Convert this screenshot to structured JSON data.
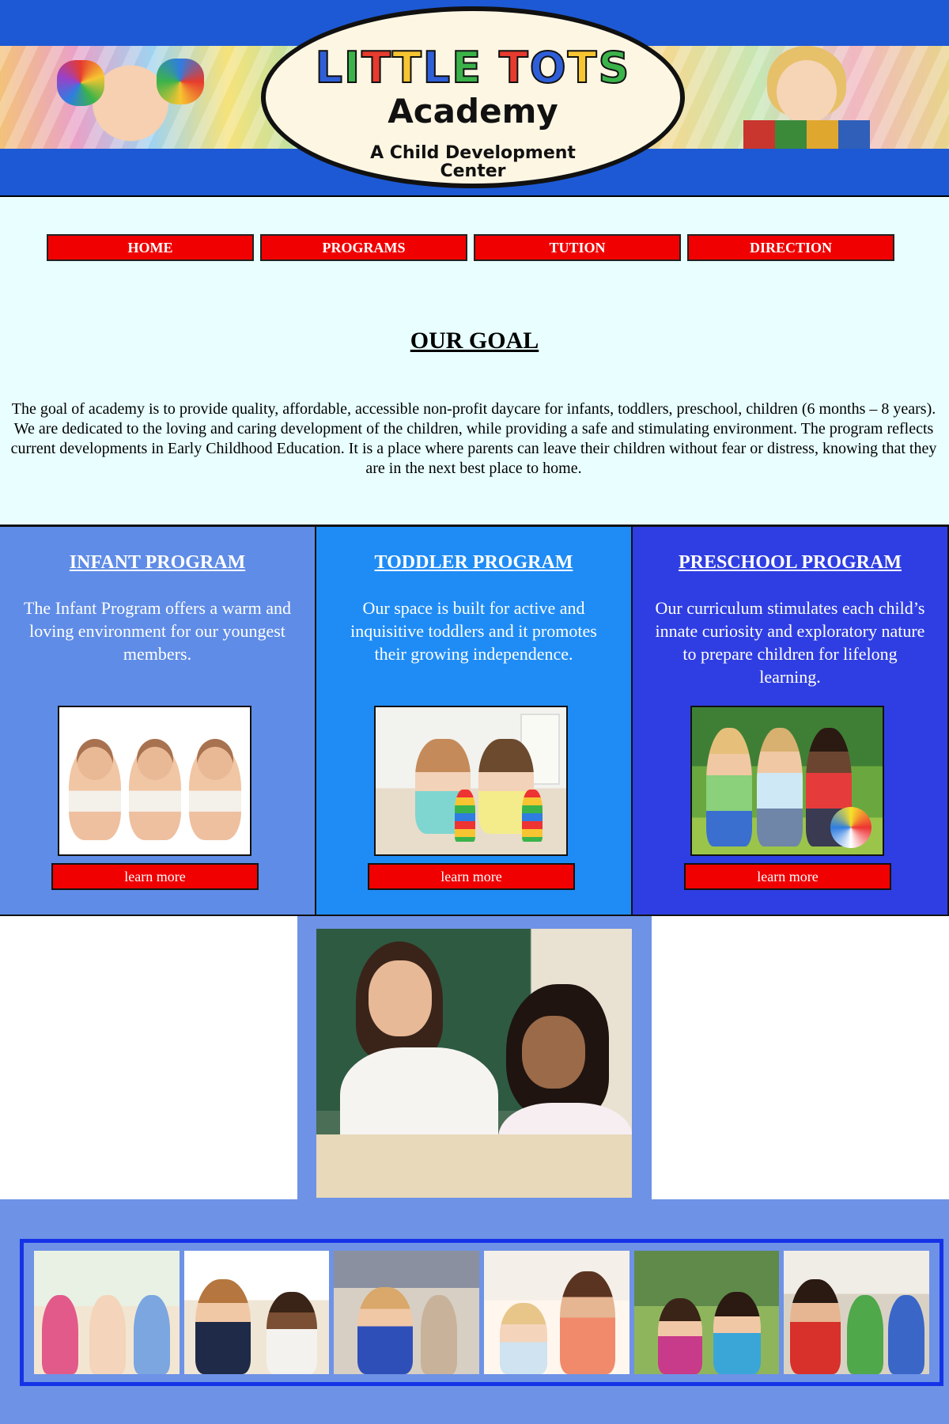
{
  "header": {
    "logo_title": "LITTLE TOTS",
    "logo_subtitle": "Academy",
    "logo_tagline_1": "A Child Development",
    "logo_tagline_2": "Center"
  },
  "nav": {
    "items": [
      "HOME",
      "PROGRAMS",
      "TUTION",
      "DIRECTION"
    ]
  },
  "goal": {
    "title": "OUR GOAL",
    "text": "The goal of academy is to provide quality, affordable, accessible non-profit daycare for infants, toddlers, preschool, children (6 months – 8 years). We are dedicated to the loving and caring development of the children, while providing a safe and stimulating environment. The program reflects current developments in Early Childhood Education. It is a place where parents can leave their children without fear or distress, knowing that they are in the next best place to home."
  },
  "programs": [
    {
      "title": "INFANT PROGRAM",
      "description": "The Infant Program offers a warm and loving environment for our youngest members.",
      "button": "learn more",
      "bg_color": "#5f8ce6"
    },
    {
      "title": "TODDLER PROGRAM",
      "description": "Our space is built for active and inquisitive toddlers and it promotes their growing independence.",
      "button": "learn more",
      "bg_color": "#1f8cf5"
    },
    {
      "title": "PRESCHOOL PROGRAM",
      "description": "Our curriculum stimulates each child’s innate curiosity and exploratory nature to prepare children for lifelong learning.",
      "button": "learn more",
      "bg_color": "#2f3ee2"
    }
  ],
  "colors": {
    "banner_blue": "#1d59d4",
    "button_red": "#f00000",
    "goal_bg": "#e9ffff",
    "section_blue": "#6e92e6",
    "gallery_border": "#1533e6"
  }
}
